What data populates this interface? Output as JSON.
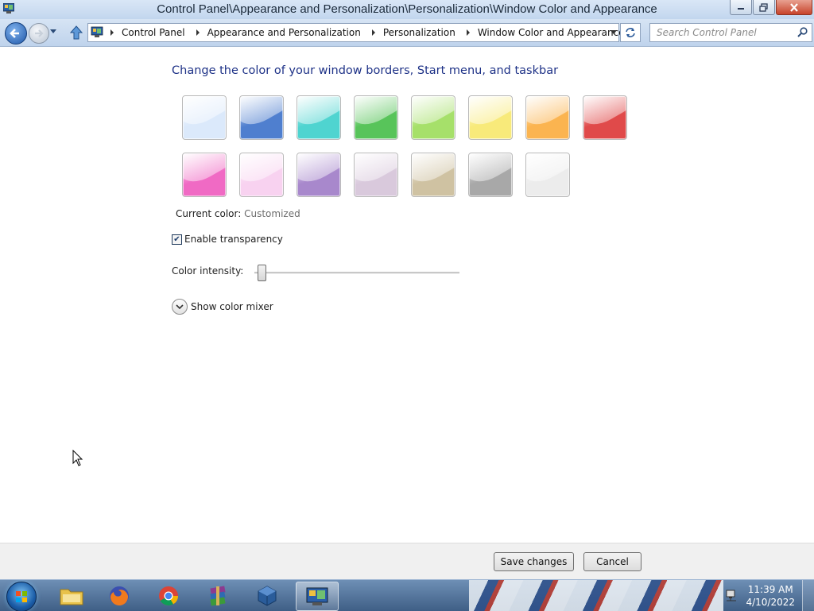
{
  "window": {
    "title": "Control Panel\\Appearance and Personalization\\Personalization\\Window Color and Appearance"
  },
  "address": {
    "breadcrumbs": [
      "Control Panel",
      "Appearance and Personalization",
      "Personalization",
      "Window Color and Appearance"
    ],
    "search_placeholder": "Search Control Panel"
  },
  "content": {
    "heading": "Change the color of your window borders, Start menu, and taskbar",
    "current_color_label": "Current color:",
    "current_color_value": "Customized",
    "transparency_label": "Enable transparency",
    "transparency_checked": true,
    "intensity_label": "Color intensity:",
    "intensity_level": 0.02,
    "mixer_label": "Show color mixer"
  },
  "swatches": [
    {
      "name": "sky",
      "color": "#dbe9fb"
    },
    {
      "name": "twilight",
      "color": "#4f7fcf"
    },
    {
      "name": "sea",
      "color": "#4fd4d0"
    },
    {
      "name": "leaf",
      "color": "#58c45a"
    },
    {
      "name": "lime",
      "color": "#a6e06a"
    },
    {
      "name": "lemon",
      "color": "#f8ea7a"
    },
    {
      "name": "pumpkin",
      "color": "#fbb450"
    },
    {
      "name": "ruby",
      "color": "#e04a4a"
    },
    {
      "name": "fuchsia",
      "color": "#f06ac4"
    },
    {
      "name": "blush",
      "color": "#f8d2f0"
    },
    {
      "name": "violet",
      "color": "#a888cc"
    },
    {
      "name": "lavender",
      "color": "#d9c9dc"
    },
    {
      "name": "taupe",
      "color": "#cfc2a2"
    },
    {
      "name": "chocolate",
      "color": "#a8a8a8"
    },
    {
      "name": "slate",
      "color": "#ececec"
    }
  ],
  "footer": {
    "save_label": "Save changes",
    "cancel_label": "Cancel"
  },
  "taskbar": {
    "items": [
      "file-explorer",
      "firefox",
      "chrome",
      "winrar",
      "virtualbox",
      "control-panel"
    ],
    "active_item": "control-panel",
    "time": "11:39 AM",
    "date": "4/10/2022"
  }
}
